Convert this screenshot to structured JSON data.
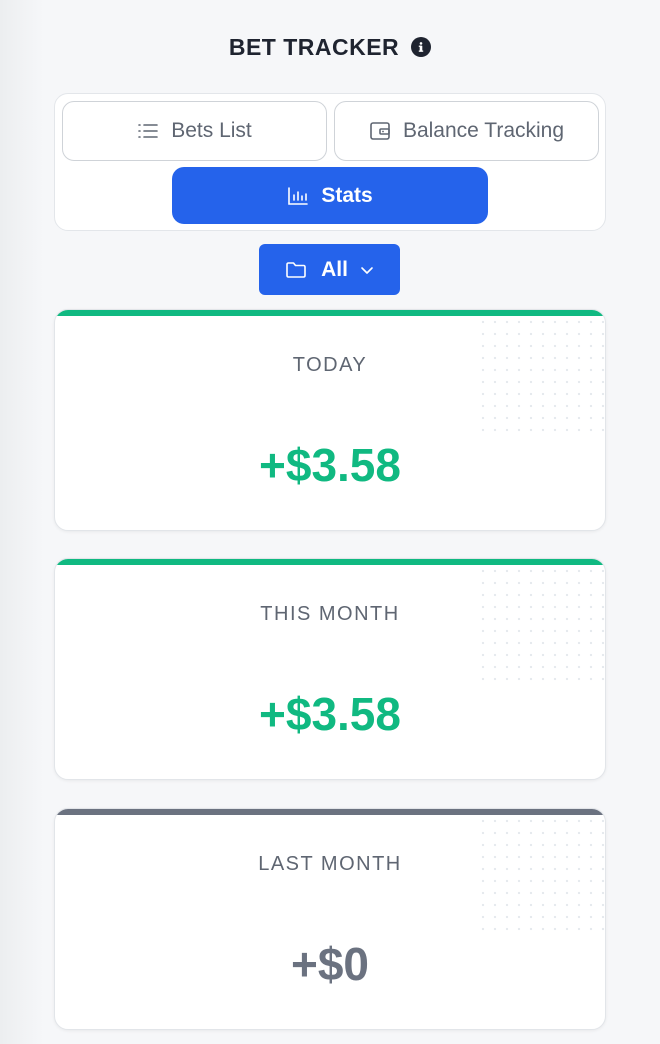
{
  "header": {
    "title": "BET TRACKER",
    "info_icon": "info-icon"
  },
  "nav": {
    "bets_list": "Bets List",
    "balance_tracking": "Balance Tracking",
    "stats": "Stats"
  },
  "filter": {
    "label": "All"
  },
  "cards": {
    "today": {
      "label": "TODAY",
      "value": "+$3.58"
    },
    "this_month": {
      "label": "THIS MONTH",
      "value": "+$3.58"
    },
    "last_month": {
      "label": "LAST MONTH",
      "value": "+$0"
    }
  },
  "colors": {
    "accent": "#2563eb",
    "positive": "#10b981",
    "neutral": "#6b7280"
  }
}
